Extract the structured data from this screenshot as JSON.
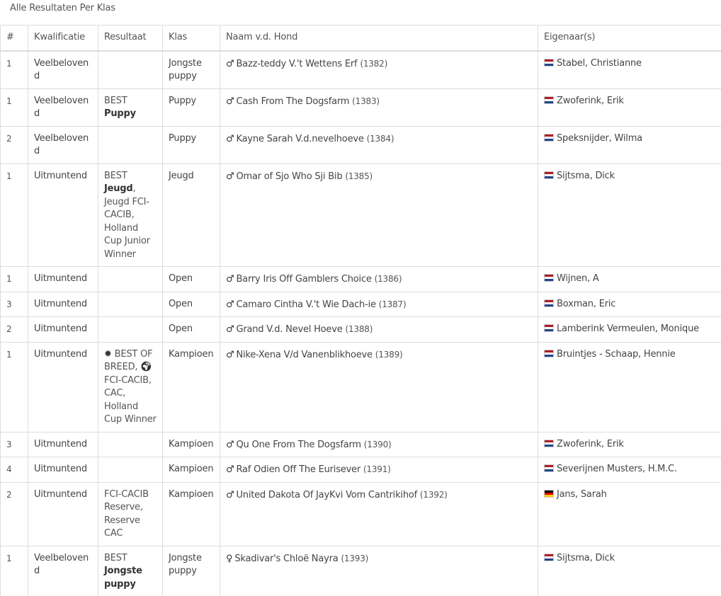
{
  "page": {
    "title": "Alle Resultaten Per Klas"
  },
  "table": {
    "headers": [
      "#",
      "Kwalificatie",
      "Resultaat",
      "Klas",
      "Naam v.d. Hond",
      "Eigenaar(s)"
    ],
    "rows": [
      {
        "pos": "1",
        "kwalificatie": "Veelbelovend",
        "resultaat": [],
        "klas": "Jongste puppy",
        "sex": "♂",
        "naam": "Bazz-teddy V.'t Wettens Erf",
        "cat": "(1382)",
        "flag": "nl",
        "eigenaar": "Stabel, Christianne"
      },
      {
        "pos": "1",
        "kwalificatie": "Veelbelovend",
        "resultaat": [
          {
            "t": "BEST "
          },
          {
            "t": "Puppy",
            "b": true
          }
        ],
        "klas": "Puppy",
        "sex": "♂",
        "naam": "Cash From The Dogsfarm",
        "cat": "(1383)",
        "flag": "nl",
        "eigenaar": "Zwoferink, Erik"
      },
      {
        "pos": "2",
        "kwalificatie": "Veelbelovend",
        "resultaat": [],
        "klas": "Puppy",
        "sex": "♂",
        "naam": "Kayne Sarah V.d.nevelhoeve",
        "cat": "(1384)",
        "flag": "nl",
        "eigenaar": "Speksnijder, Wilma"
      },
      {
        "pos": "1",
        "kwalificatie": "Uitmuntend",
        "resultaat": [
          {
            "t": "BEST "
          },
          {
            "t": "Jeugd",
            "b": true
          },
          {
            "t": ", Jeugd FCI-CACIB, Holland Cup Junior Winner"
          }
        ],
        "klas": "Jeugd",
        "sex": "♂",
        "naam": "Omar of Sjo Who Sji Bib",
        "cat": "(1385)",
        "flag": "nl",
        "eigenaar": "Sijtsma, Dick"
      },
      {
        "pos": "1",
        "kwalificatie": "Uitmuntend",
        "resultaat": [],
        "klas": "Open",
        "sex": "♂",
        "naam": "Barry Iris Off Gamblers Choice",
        "cat": "(1386)",
        "flag": "nl",
        "eigenaar": "Wijnen, A"
      },
      {
        "pos": "3",
        "kwalificatie": "Uitmuntend",
        "resultaat": [],
        "klas": "Open",
        "sex": "♂",
        "naam": "Camaro Cintha V.'t Wie Dach-ie",
        "cat": "(1387)",
        "flag": "nl",
        "eigenaar": "Boxman, Eric"
      },
      {
        "pos": "2",
        "kwalificatie": "Uitmuntend",
        "resultaat": [],
        "klas": "Open",
        "sex": "♂",
        "naam": "Grand V.d. Nevel Hoeve",
        "cat": "(1388)",
        "flag": "nl",
        "eigenaar": "Lamberink Vermeulen, Monique"
      },
      {
        "pos": "1",
        "kwalificatie": "Uitmuntend",
        "resultaat": [
          {
            "icon": "sun-burst-icon",
            "g": "✹"
          },
          {
            "t": " BEST OF BREED, "
          },
          {
            "icon": "globe-icon",
            "g": "🌍︎"
          },
          {
            "t": " FCI-CACIB, CAC, Holland Cup Winner"
          }
        ],
        "klas": "Kampioen",
        "sex": "♂",
        "naam": "Nike-Xena V/d Vanenblikhoeve",
        "cat": "(1389)",
        "flag": "nl",
        "eigenaar": "Bruintjes - Schaap, Hennie"
      },
      {
        "pos": "3",
        "kwalificatie": "Uitmuntend",
        "resultaat": [],
        "klas": "Kampioen",
        "sex": "♂",
        "naam": "Qu One From The Dogsfarm",
        "cat": "(1390)",
        "flag": "nl",
        "eigenaar": "Zwoferink, Erik"
      },
      {
        "pos": "4",
        "kwalificatie": "Uitmuntend",
        "resultaat": [],
        "klas": "Kampioen",
        "sex": "♂",
        "naam": "Raf Odien Off The Eurisever",
        "cat": "(1391)",
        "flag": "nl",
        "eigenaar": "Severijnen Musters, H.M.C."
      },
      {
        "pos": "2",
        "kwalificatie": "Uitmuntend",
        "resultaat": [
          {
            "t": "FCI-CACIB Reserve, Reserve CAC"
          }
        ],
        "klas": "Kampioen",
        "sex": "♂",
        "naam": "United Dakota Of JayKvi Vom Cantrikihof",
        "cat": "(1392)",
        "flag": "de",
        "eigenaar": "Jans, Sarah"
      },
      {
        "pos": "1",
        "kwalificatie": "Veelbelovend",
        "resultaat": [
          {
            "t": "BEST "
          },
          {
            "t": "Jongste puppy",
            "b": true
          }
        ],
        "klas": "Jongste puppy",
        "sex": "♀",
        "naam": "Skadivar's Chloë Nayra",
        "cat": "(1393)",
        "flag": "nl",
        "eigenaar": "Sijtsma, Dick"
      }
    ]
  }
}
